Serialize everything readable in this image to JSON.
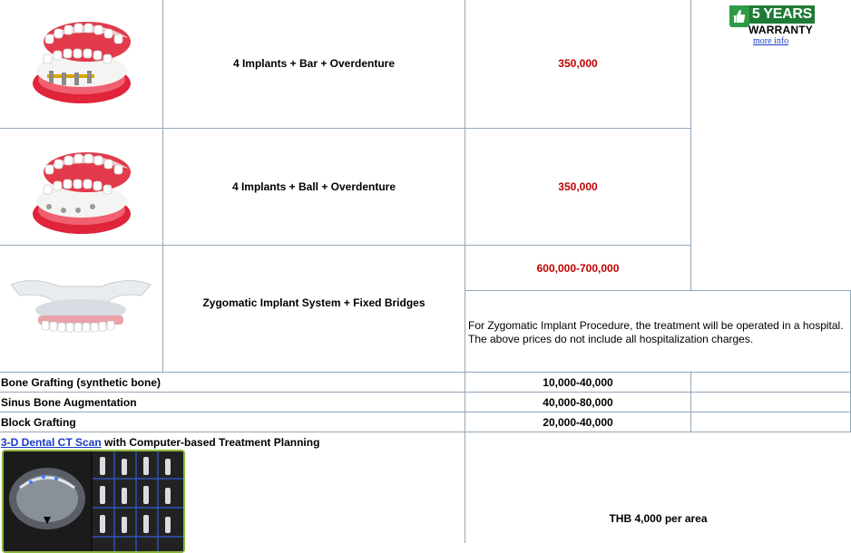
{
  "warranty": {
    "years_label": "5 YEARS",
    "warranty_label": "WARRANTY",
    "more_info_label": "more info"
  },
  "rows": [
    {
      "image": "overdenture-bar-image",
      "name": "4 Implants + Bar + Overdenture",
      "price": "350,000"
    },
    {
      "image": "overdenture-ball-image",
      "name": "4 Implants + Ball + Overdenture",
      "price": "350,000"
    },
    {
      "image": "zygomatic-implant-image",
      "name": "Zygomatic Implant System + Fixed Bridges",
      "price": "600,000-700,000",
      "note_line1": "For Zygomatic Implant Procedure, the treatment will be operated in a hospital.",
      "note_line2": "The above prices do not include all hospitalization charges."
    }
  ],
  "grafting": [
    {
      "name": "Bone Grafting (synthetic bone)",
      "price": "10,000-40,000"
    },
    {
      "name": "Sinus Bone Augmentation",
      "price": "40,000-80,000"
    },
    {
      "name": "Block Grafting",
      "price": "20,000-40,000"
    }
  ],
  "ct_scan": {
    "link_label": "3-D Dental CT Scan",
    "suffix": " with Computer-based Treatment Planning",
    "price": "THB 4,000 per area"
  },
  "colors": {
    "price_red": "#c00000",
    "grid_line": "#94a7b9",
    "badge_green": "#1e7a36",
    "link_blue": "#1a3cc7"
  }
}
